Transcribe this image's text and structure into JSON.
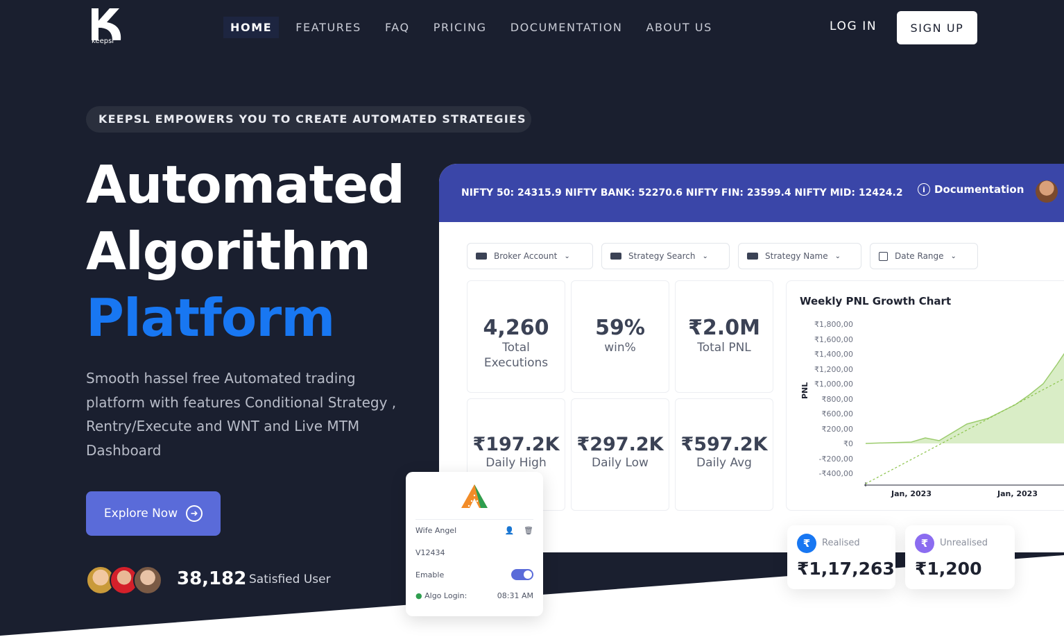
{
  "brand": {
    "logo_text": "keepsl"
  },
  "nav": {
    "items": [
      "HOME",
      "FEATURES",
      "FAQ",
      "PRICING",
      "DOCUMENTATION",
      "ABOUT US"
    ],
    "login": "LOG IN",
    "signup": "SIGN UP"
  },
  "hero": {
    "pill": "KEEPSL EMPOWERS YOU TO CREATE AUTOMATED STRATEGIES",
    "title_line1": "Automated",
    "title_line2": "Algorithm",
    "title_line3": "Platform",
    "subtitle": "Smooth hassel free Automated trading platform with features Conditional Strategy , Rentry/Execute and WNT and Live MTM Dashboard",
    "cta": "Explore Now",
    "users_count": "38,182",
    "users_label": "Satisfied User"
  },
  "dashboard": {
    "ticker": "NIFTY 50: 24315.9 NIFTY BANK: 52270.6 NIFTY FIN: 23599.4 NIFTY MID: 12424.2",
    "doc_link": "Documentation",
    "filters": [
      "Broker Account",
      "Strategy Search",
      "Strategy Name",
      "Date Range"
    ],
    "stats": [
      {
        "value": "4,260",
        "label": "Total Executions"
      },
      {
        "value": "59%",
        "label": "win%"
      },
      {
        "value": "₹2.0M",
        "label": "Total PNL"
      },
      {
        "value": "₹197.2K",
        "label": "Daily High"
      },
      {
        "value": "₹297.2K",
        "label": "Daily Low"
      },
      {
        "value": "₹597.2K",
        "label": "Daily Avg"
      }
    ],
    "chart_title": "Weekly PNL Growth Chart",
    "chart_ylabel": "PNL",
    "chart_yticks": [
      "₹1,800,00",
      "₹1,600,00",
      "₹1,400,00",
      "₹1,200,00",
      "₹1,000,00",
      "₹800,00",
      "₹600,00",
      "₹200,00",
      "₹0",
      "-₹200,00",
      "-₹400,00"
    ],
    "chart_xticks": [
      "Jan, 2023",
      "Jan, 2023"
    ]
  },
  "angel_card": {
    "name": "Wife Angel",
    "id": "V12434",
    "enable_label": "Emable",
    "algo_label": "Algo Login:",
    "algo_time": "08:31 AM"
  },
  "pnl": {
    "realised_label": "Realised",
    "realised_value": "₹1,17,263",
    "unrealised_label": "Unrealised",
    "unrealised_value": "₹1,200",
    "realised_color": "#1877f2",
    "unrealised_color": "#8b6cf0"
  },
  "colors": {
    "hero_bg": "#1a1f2f",
    "accent_blue": "#1877f2",
    "button_purple": "#5a6bd9",
    "dash_header": "#3a46a8"
  }
}
